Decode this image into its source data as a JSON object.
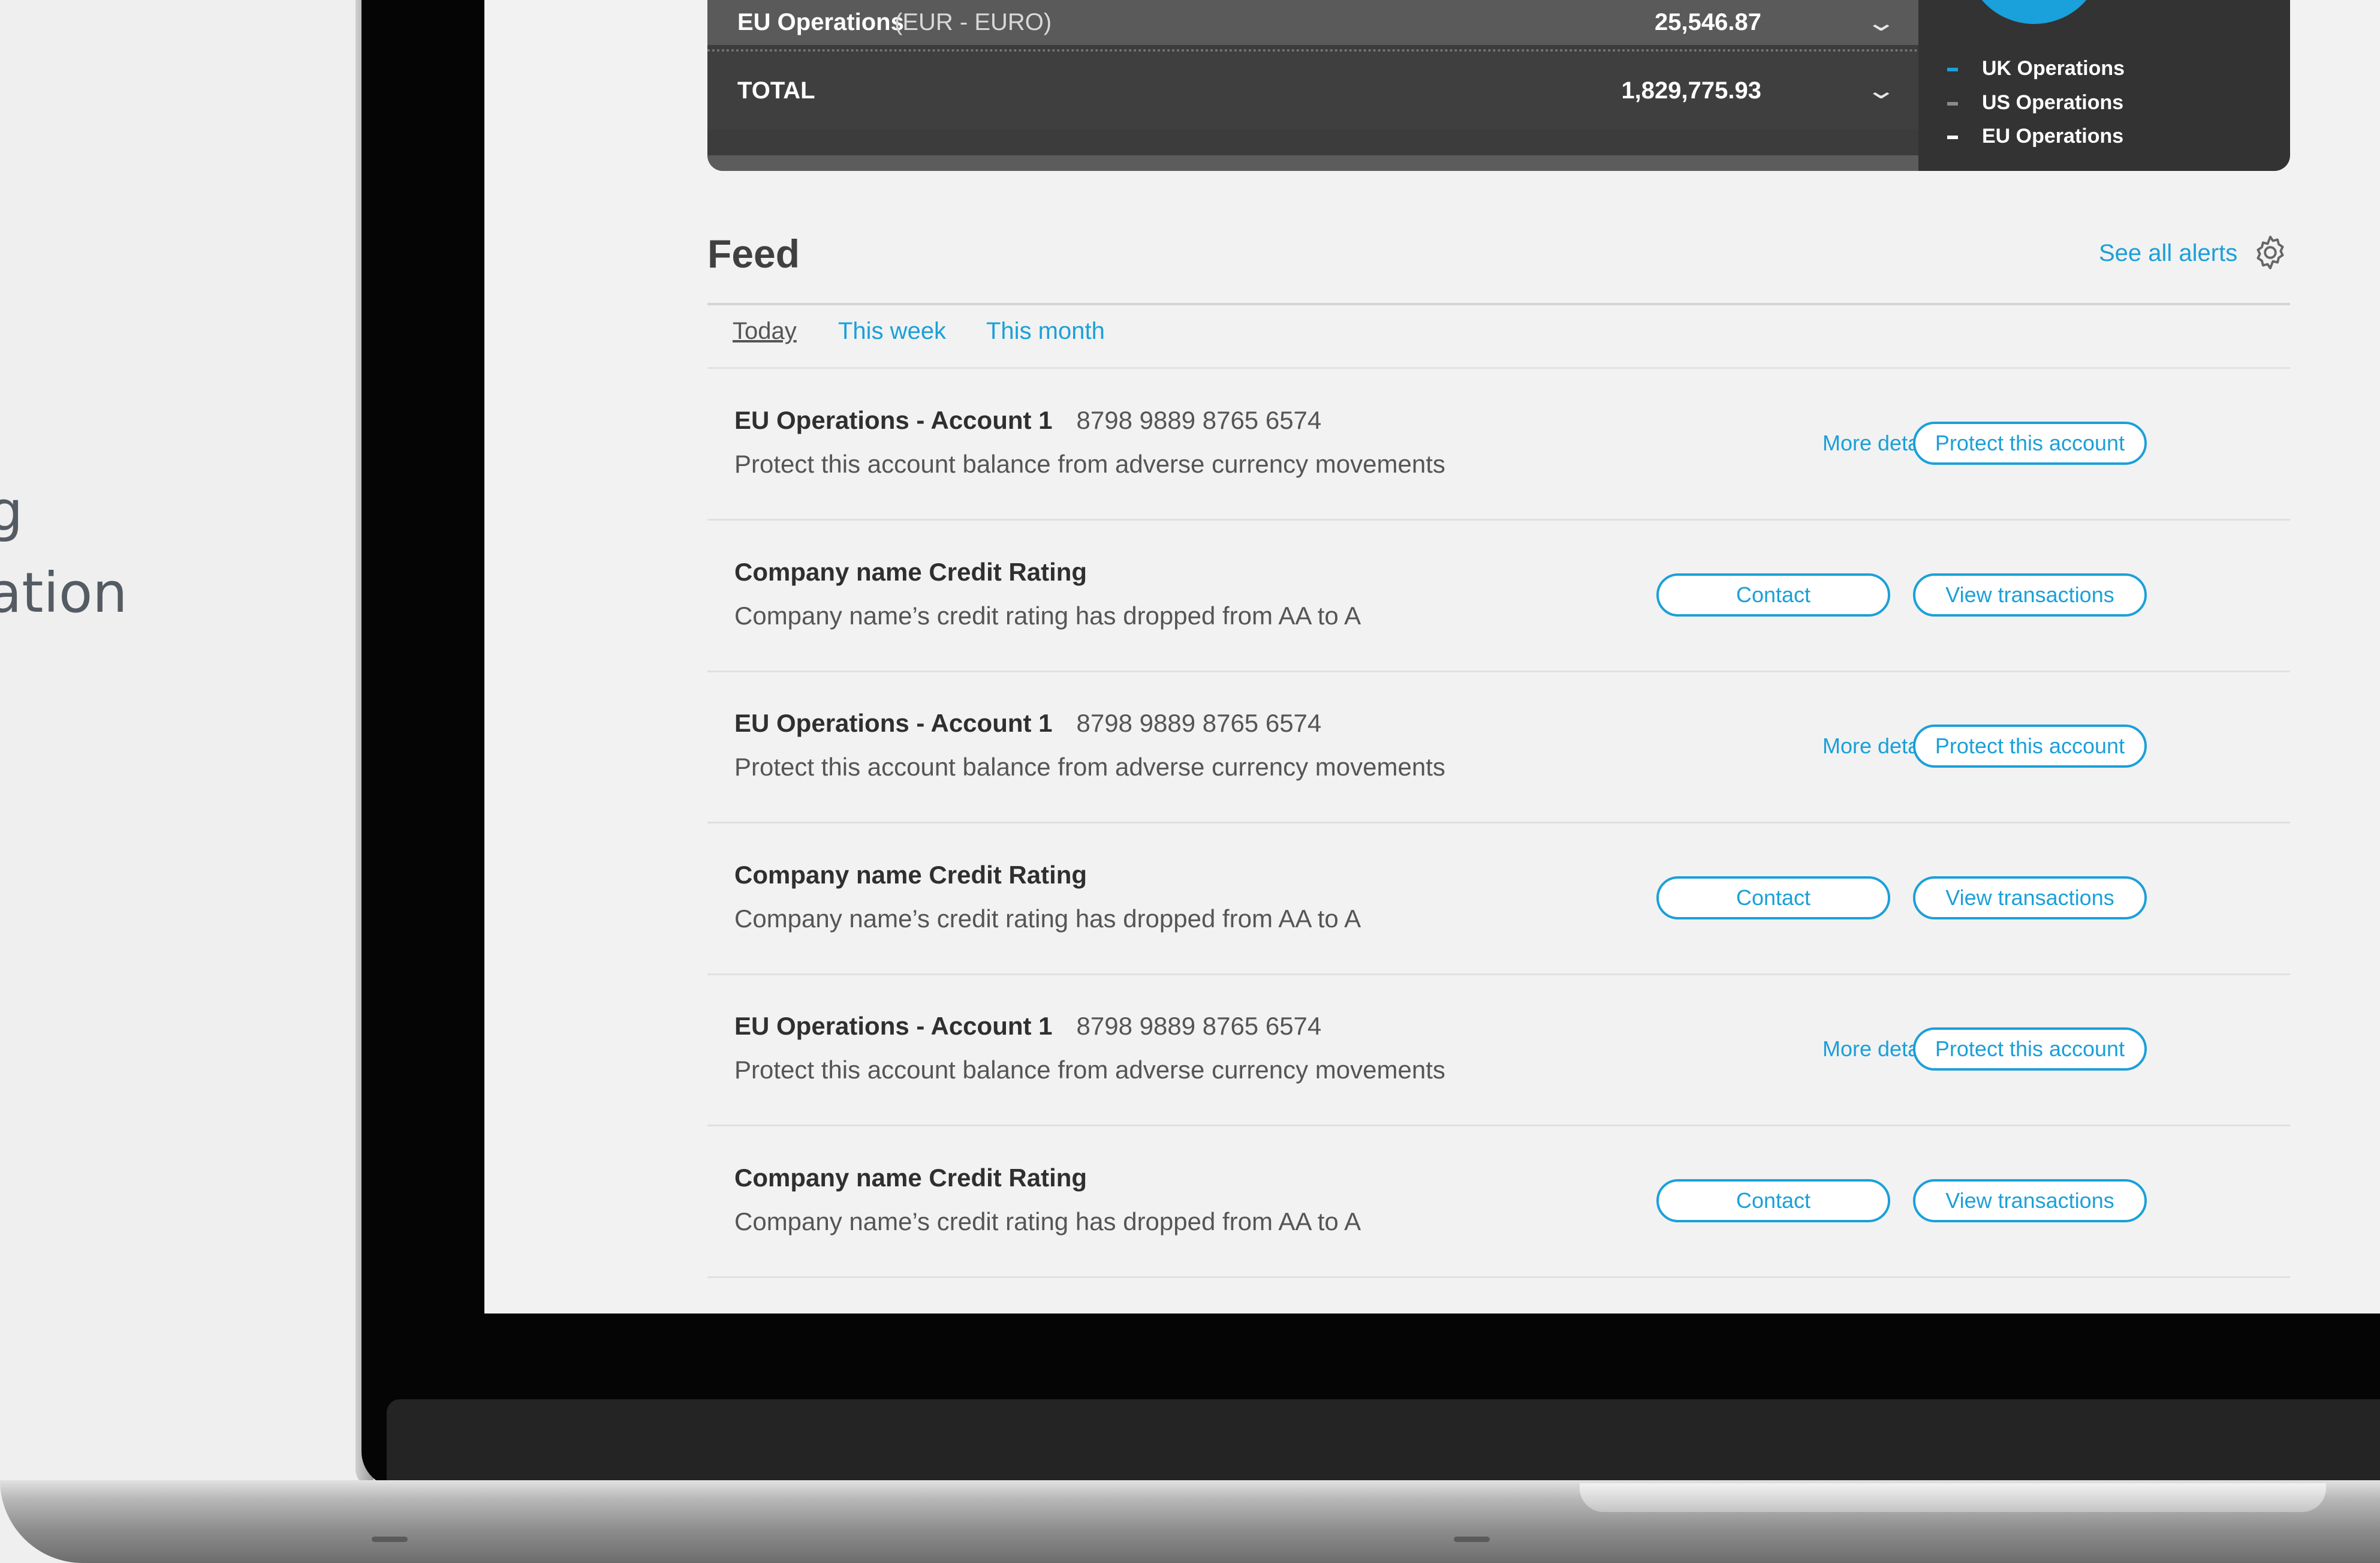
{
  "side_text": {
    "line1": "g",
    "line2": "ation"
  },
  "accounts": {
    "rows": [
      {
        "name": "EU Operations",
        "currency": "(EUR - EURO)",
        "amount": "25,546.87"
      },
      {
        "name": "TOTAL",
        "currency": "",
        "amount": "1,829,775.93"
      }
    ],
    "legend": [
      {
        "label": "UK Operations",
        "color": "#1aa0db"
      },
      {
        "label": "US Operations",
        "color": "#8a8a8a"
      },
      {
        "label": "EU Operations",
        "color": "#ffffff"
      }
    ]
  },
  "feed": {
    "title": "Feed",
    "see_all": "See all alerts",
    "tabs": [
      "Today",
      "This week",
      "This month"
    ],
    "items": [
      {
        "title": "EU Operations - Account 1",
        "account_number": "8798 9889 8765 6574",
        "description": "Protect this account balance from adverse currency movements",
        "more": "More details ⌄",
        "button": "Protect this account"
      },
      {
        "title": "Company name Credit Rating",
        "account_number": "",
        "description": "Company name’s credit rating has dropped from AA to A",
        "left_button": "Contact",
        "button": "View transactions"
      },
      {
        "title": "EU Operations - Account 1",
        "account_number": "8798 9889 8765 6574",
        "description": "Protect this account balance from adverse currency movements",
        "more": "More details ⌄",
        "button": "Protect this account"
      },
      {
        "title": "Company name Credit Rating",
        "account_number": "",
        "description": "Company name’s credit rating has dropped from AA to A",
        "left_button": "Contact",
        "button": "View transactions"
      },
      {
        "title": "EU Operations - Account 1",
        "account_number": "8798 9889 8765 6574",
        "description": "Protect this account balance from adverse currency movements",
        "more": "More details ⌄",
        "button": "Protect this account"
      },
      {
        "title": "Company name Credit Rating",
        "account_number": "",
        "description": "Company name’s credit rating has dropped from AA to A",
        "left_button": "Contact",
        "button": "View transactions"
      }
    ]
  },
  "colors": {
    "accent": "#1ba0d9",
    "panel_dark": "#3c3c3c"
  }
}
